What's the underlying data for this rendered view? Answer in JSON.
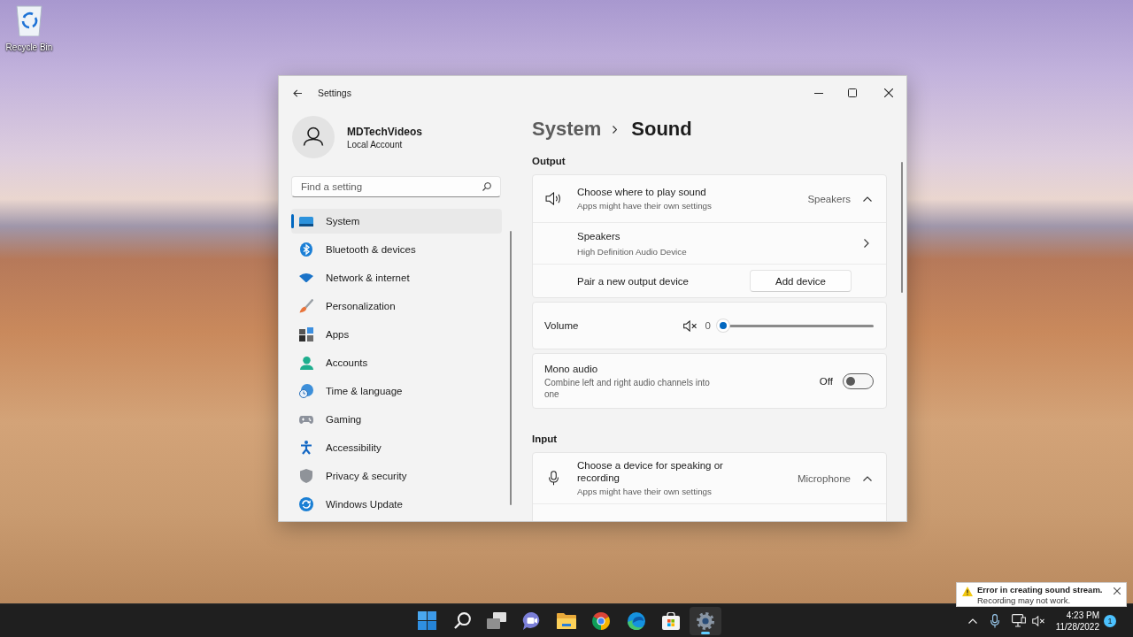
{
  "desktop": {
    "icons": [
      {
        "label": "Recycle Bin"
      }
    ]
  },
  "window": {
    "title": "Settings"
  },
  "account": {
    "name": "MDTechVideos",
    "type": "Local Account"
  },
  "search": {
    "placeholder": "Find a setting"
  },
  "sidebar": {
    "items": [
      {
        "label": "System",
        "selected": true
      },
      {
        "label": "Bluetooth & devices",
        "selected": false
      },
      {
        "label": "Network & internet",
        "selected": false
      },
      {
        "label": "Personalization",
        "selected": false
      },
      {
        "label": "Apps",
        "selected": false
      },
      {
        "label": "Accounts",
        "selected": false
      },
      {
        "label": "Time & language",
        "selected": false
      },
      {
        "label": "Gaming",
        "selected": false
      },
      {
        "label": "Accessibility",
        "selected": false
      },
      {
        "label": "Privacy & security",
        "selected": false
      },
      {
        "label": "Windows Update",
        "selected": false
      }
    ]
  },
  "breadcrumb": {
    "parent": "System",
    "current": "Sound"
  },
  "sections": [
    {
      "heading": "Output",
      "cards": [
        {
          "rows": [
            {
              "kind": "expander",
              "title": "Choose where to play sound",
              "subtitle": "Apps might have their own settings",
              "value": "Speakers",
              "expanded": true
            },
            {
              "kind": "link",
              "title": "Speakers",
              "subtitle": "High Definition Audio Device"
            },
            {
              "kind": "action",
              "title": "Pair a new output device",
              "button": "Add device"
            }
          ]
        },
        {
          "rows": [
            {
              "kind": "slider",
              "title": "Volume",
              "muted": true,
              "reading": "0",
              "level": 0
            }
          ]
        },
        {
          "rows": [
            {
              "kind": "toggle",
              "title": "Mono audio",
              "subtitle": "Combine left and right audio channels into one",
              "state_label": "Off",
              "on": false
            }
          ]
        }
      ]
    },
    {
      "heading": "Input",
      "cards": [
        {
          "rows": [
            {
              "kind": "expander",
              "title": "Choose a device for speaking or recording",
              "subtitle": "Apps might have their own settings",
              "value": "Microphone",
              "expanded": true
            }
          ]
        }
      ]
    }
  ],
  "taskbar": {
    "apps": [
      {
        "active": false
      },
      {
        "active": false
      },
      {
        "active": false
      },
      {
        "active": false
      },
      {
        "active": false
      },
      {
        "active": false
      },
      {
        "active": false
      },
      {
        "active": false
      },
      {
        "active": true
      }
    ]
  },
  "tray": {
    "time": "4:23 PM",
    "date": "11/28/2022",
    "notifications": "1"
  },
  "toast": {
    "title": "Error in creating sound stream.",
    "message": "Recording may not work."
  }
}
